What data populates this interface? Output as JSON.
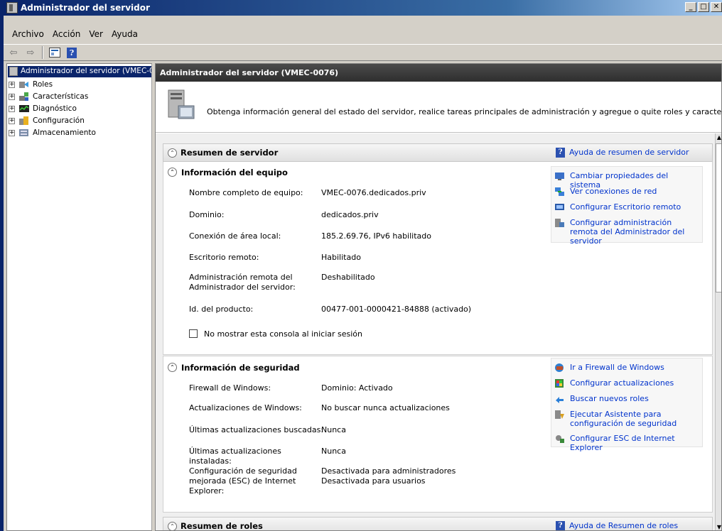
{
  "window": {
    "title": "Administrador del servidor"
  },
  "menu": [
    "Archivo",
    "Acción",
    "Ver",
    "Ayuda"
  ],
  "tree": {
    "root": "Administrador del servidor (VMEC-0",
    "items": [
      "Roles",
      "Características",
      "Diagnóstico",
      "Configuración",
      "Almacenamiento"
    ]
  },
  "content": {
    "header": "Administrador del servidor (VMEC-0076)",
    "intro": "Obtenga información general del estado del servidor, realice tareas principales de administración y agregue o quite roles y características de servidor."
  },
  "summary": {
    "title": "Resumen de servidor",
    "help": "Ayuda de resumen de servidor",
    "equipment": {
      "title": "Información del equipo",
      "rows": [
        {
          "label": "Nombre completo de equipo:",
          "value": "VMEC-0076.dedicados.priv"
        },
        {
          "label": "Dominio:",
          "value": "dedicados.priv"
        },
        {
          "label": "Conexión de área local:",
          "value": "185.2.69.76, IPv6 habilitado"
        },
        {
          "label": "Escritorio remoto:",
          "value": "Habilitado"
        },
        {
          "label": "Administración remota del Administrador del servidor:",
          "value": "Deshabilitado"
        },
        {
          "label": "Id. del producto:",
          "value": "00477-001-0000421-84888 (activado)"
        }
      ],
      "checkbox_label": "No mostrar esta consola al iniciar sesión",
      "tasks": [
        "Cambiar propiedades del sistema",
        "Ver conexiones de red",
        "Configurar Escritorio remoto",
        "Configurar administración remota del Administrador del servidor"
      ]
    },
    "security": {
      "title": "Información de seguridad",
      "rows": [
        {
          "label": "Firewall de Windows:",
          "value": "Dominio: Activado"
        },
        {
          "label": "Actualizaciones de Windows:",
          "value": "No buscar nunca actualizaciones"
        },
        {
          "label": "Últimas actualizaciones buscadas:",
          "value": "Nunca"
        },
        {
          "label": "Últimas actualizaciones instaladas:",
          "value": "Nunca"
        },
        {
          "label": "Configuración de seguridad mejorada (ESC) de Internet Explorer:",
          "value": "Desactivada para administradores",
          "value2": "Desactivada para usuarios"
        }
      ],
      "tasks": [
        "Ir a Firewall de Windows",
        "Configurar actualizaciones",
        "Buscar nuevos roles",
        "Ejecutar Asistente para configuración de seguridad",
        "Configurar ESC de Internet Explorer"
      ]
    }
  },
  "roles": {
    "title": "Resumen de roles",
    "help": "Ayuda de Resumen de roles"
  }
}
